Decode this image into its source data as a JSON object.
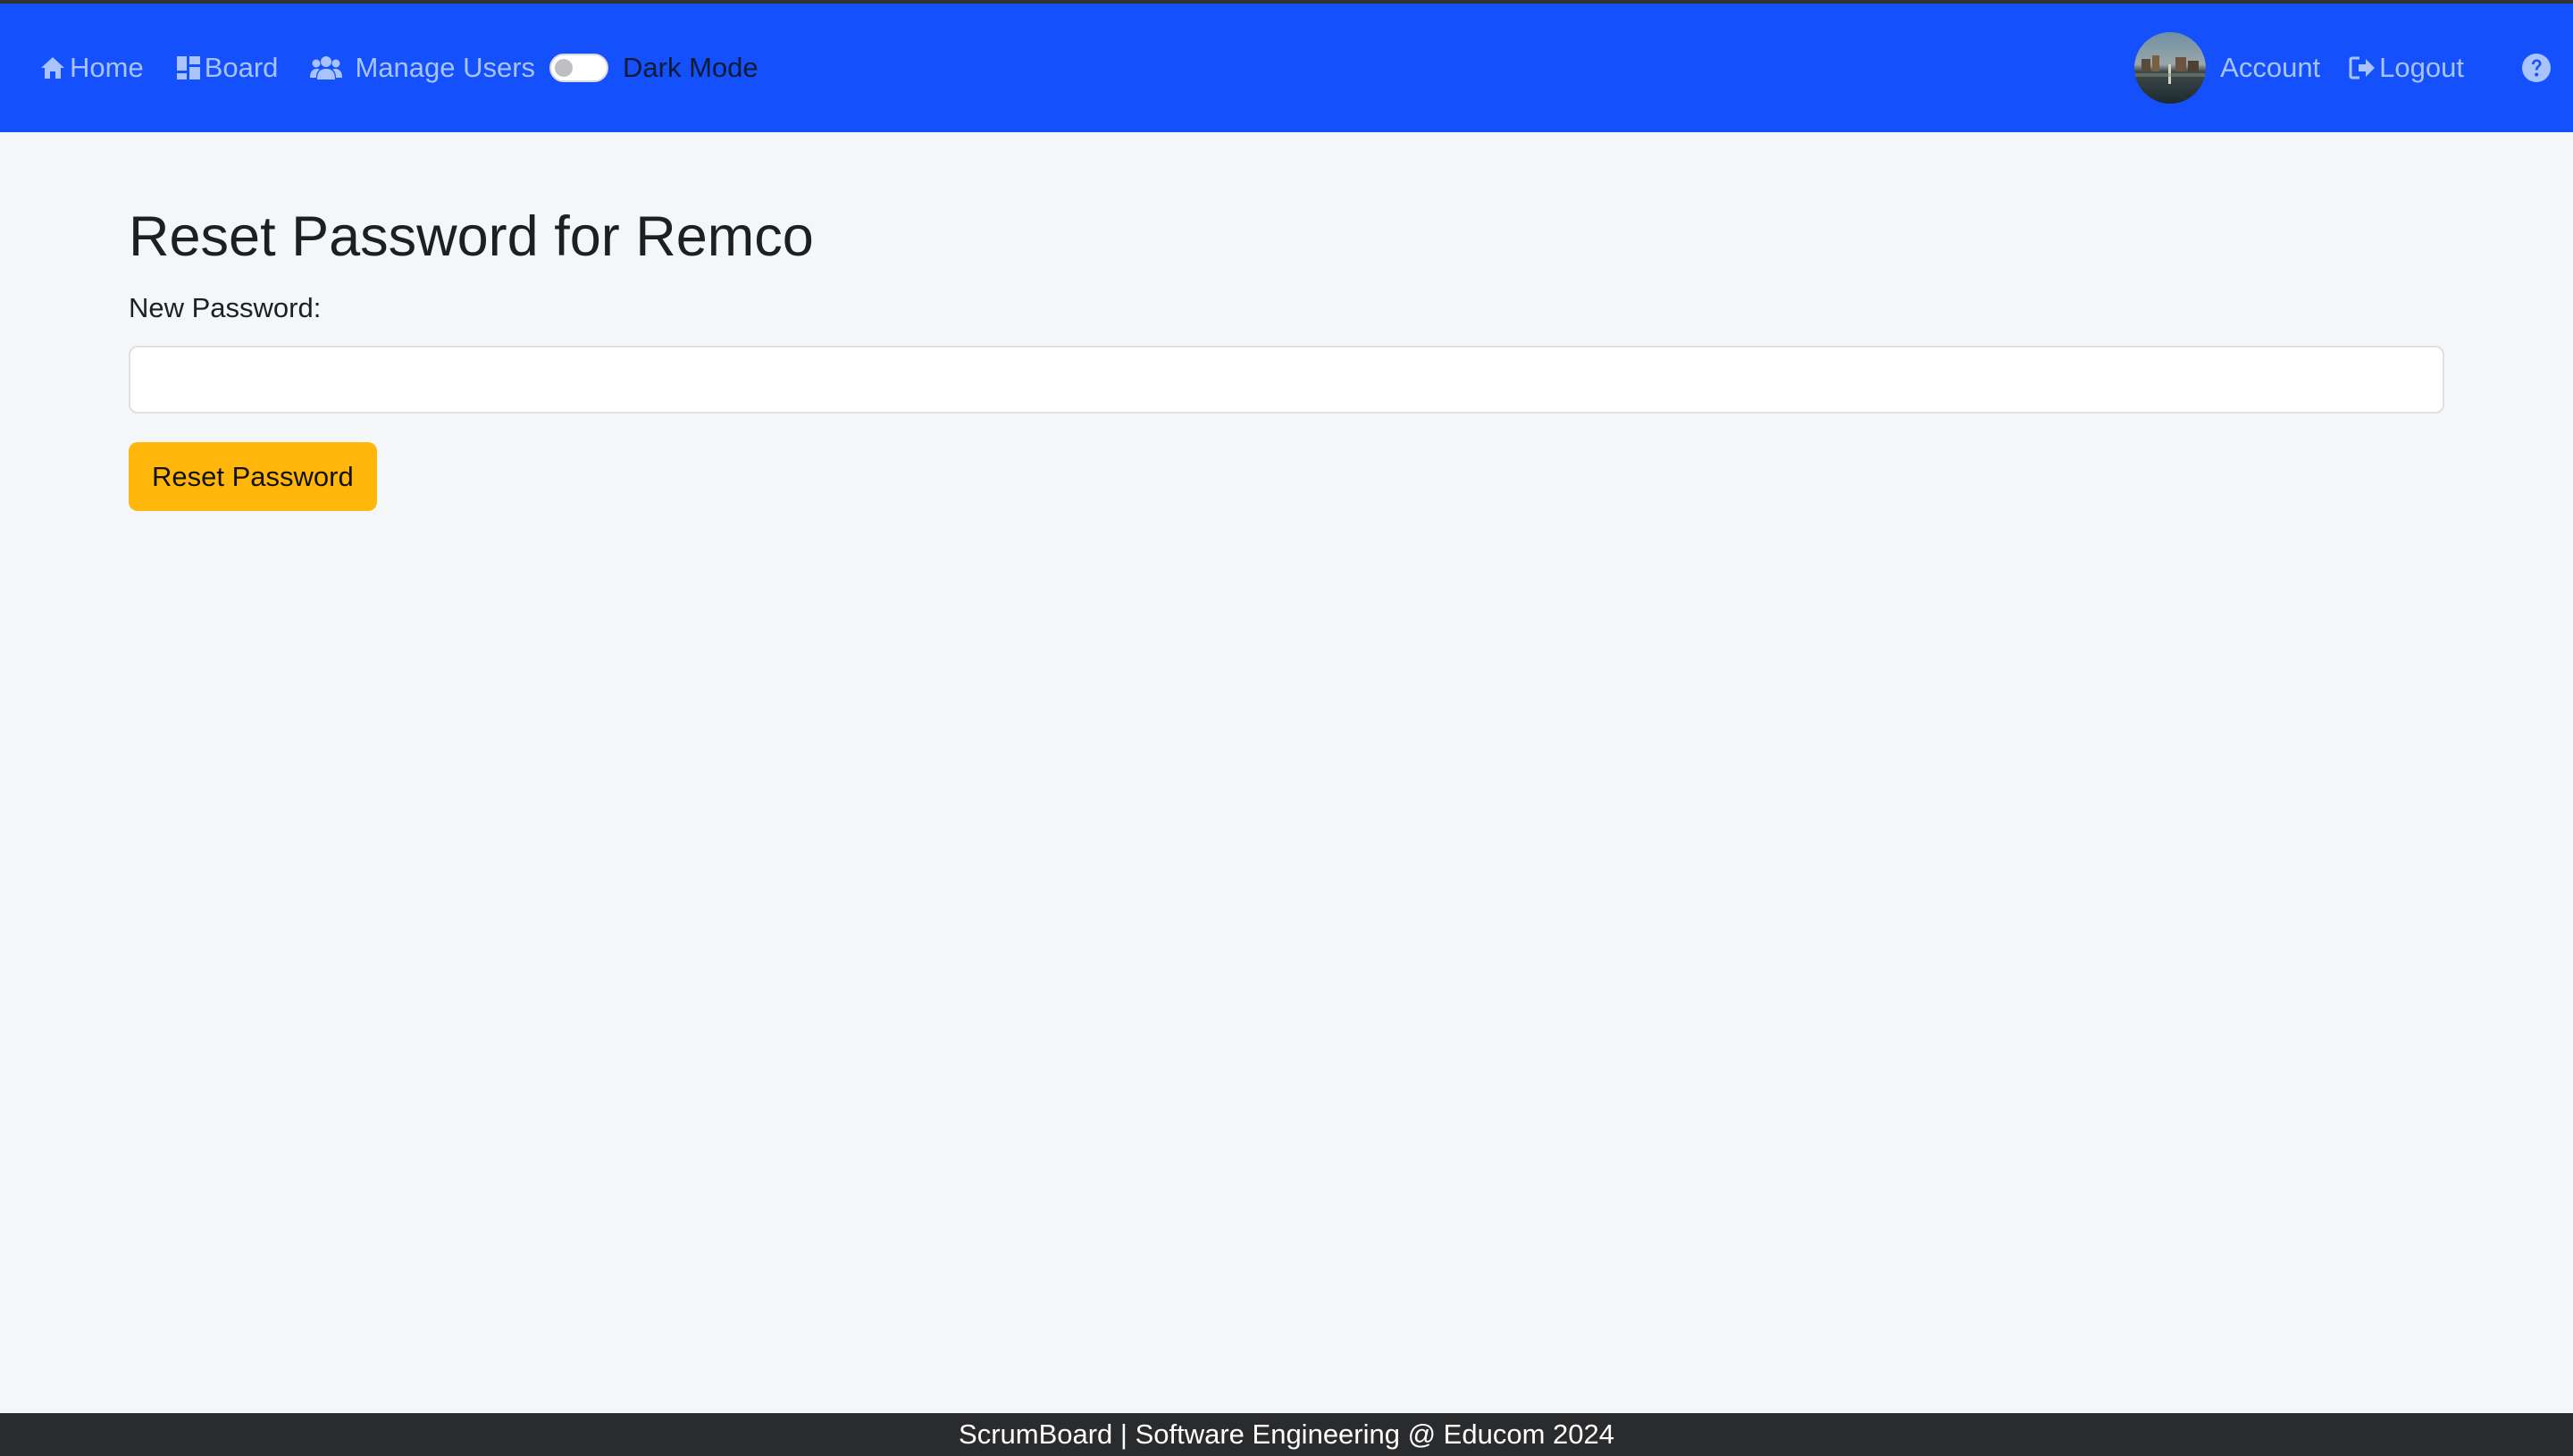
{
  "nav": {
    "home_label": "Home",
    "home_icon": "home-icon",
    "board_label": "Board",
    "board_icon": "board-icon",
    "manage_users_label": "Manage Users",
    "manage_users_icon": "users-icon",
    "dark_mode_label": "Dark Mode",
    "dark_mode_enabled": false,
    "account_label": "Account",
    "logout_label": "Logout",
    "logout_icon": "logout-icon",
    "help_icon": "question-circle-icon"
  },
  "page": {
    "title": "Reset Password for Remco",
    "password_label": "New Password:",
    "password_value": "",
    "submit_label": "Reset Password"
  },
  "footer": {
    "text": "ScrumBoard | Software Engineering @ Educom 2024"
  },
  "colors": {
    "navbar": "#1450fb",
    "nav_link": "#a9c3ff",
    "button": "#ffb70b",
    "footer": "#2a2b2d",
    "page_background": "#f5f6f8"
  }
}
